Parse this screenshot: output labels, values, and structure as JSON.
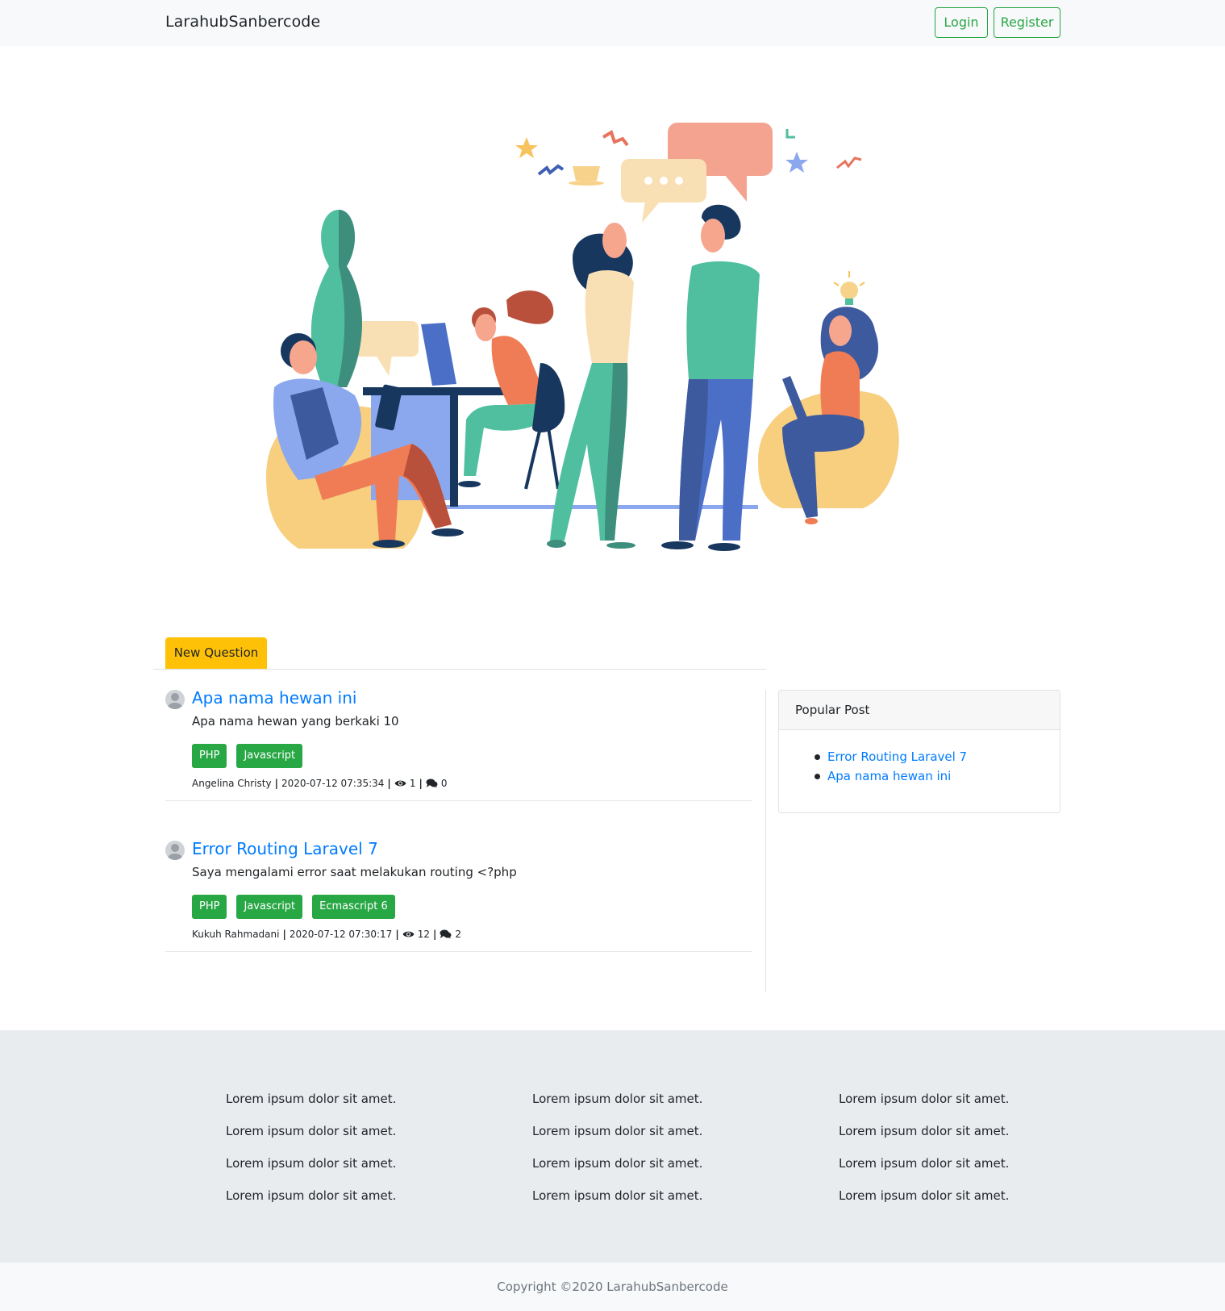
{
  "navbar": {
    "brand": "LarahubSanbercode",
    "login_label": "Login",
    "register_label": "Register"
  },
  "colors": {
    "accent_green": "#28a745",
    "link_blue": "#007bff",
    "tab_yellow": "#ffc107"
  },
  "tabs": {
    "new_question": "New Question"
  },
  "questions": [
    {
      "title": "Apa nama hewan ini",
      "body": "Apa nama hewan yang berkaki 10",
      "tags": [
        "PHP",
        "Javascript"
      ],
      "author": "Angelina Christy",
      "date": "2020-07-12 07:35:34",
      "views": "1",
      "answers": "0"
    },
    {
      "title": "Error Routing Laravel 7",
      "body": "Saya mengalami error saat melakukan routing <?php",
      "tags": [
        "PHP",
        "Javascript",
        "Ecmascript 6"
      ],
      "author": "Kukuh Rahmadani",
      "date": "2020-07-12 07:30:17",
      "views": "12",
      "answers": "2"
    }
  ],
  "sidebar": {
    "title": "Popular Post",
    "items": [
      "Error Routing Laravel 7",
      "Apa nama hewan ini"
    ]
  },
  "footer": {
    "columns": [
      [
        "Lorem ipsum dolor sit amet.",
        "Lorem ipsum dolor sit amet.",
        "Lorem ipsum dolor sit amet.",
        "Lorem ipsum dolor sit amet."
      ],
      [
        "Lorem ipsum dolor sit amet.",
        "Lorem ipsum dolor sit amet.",
        "Lorem ipsum dolor sit amet.",
        "Lorem ipsum dolor sit amet."
      ],
      [
        "Lorem ipsum dolor sit amet.",
        "Lorem ipsum dolor sit amet.",
        "Lorem ipsum dolor sit amet.",
        "Lorem ipsum dolor sit amet."
      ]
    ],
    "copyright": "Copyright ©2020 LarahubSanbercode"
  },
  "icons": {
    "views": "eye-icon",
    "answers": "comments-icon",
    "avatar": "user-avatar-icon"
  }
}
